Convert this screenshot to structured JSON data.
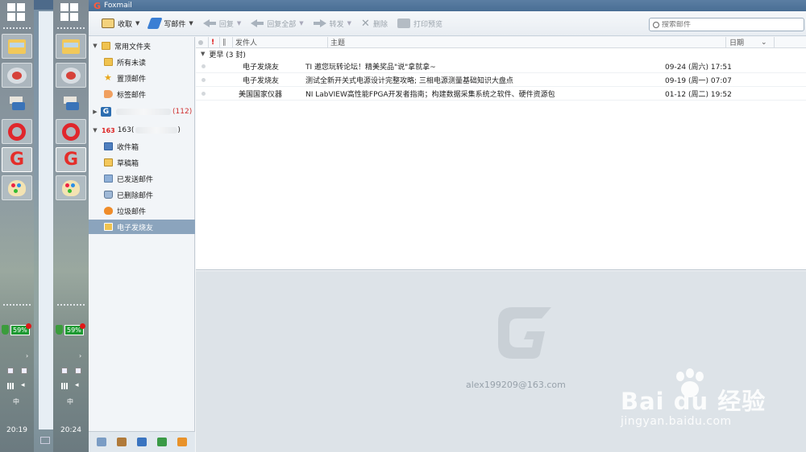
{
  "window": {
    "title": "Foxmail"
  },
  "toolbar": {
    "receive": "收取",
    "compose": "写邮件",
    "reply": "回复",
    "reply_all": "回复全部",
    "forward": "转发",
    "delete": "删除",
    "print_preview": "打印预览"
  },
  "search": {
    "placeholder": "搜索邮件"
  },
  "tree": {
    "common_folder": "常用文件夹",
    "common_items": [
      "所有未读",
      "置顶邮件",
      "标签邮件"
    ],
    "account2_count": "(112)",
    "account163_prefix": "163",
    "account163_label": "163(",
    "account163_suffix": ")",
    "account163_items": [
      "收件箱",
      "草稿箱",
      "已发送邮件",
      "已删除邮件",
      "垃圾邮件",
      "电子发烧友"
    ]
  },
  "list": {
    "col_sender": "发件人",
    "col_subject": "主题",
    "col_date": "日期",
    "group_label": "更早 (3 封)",
    "rows": [
      {
        "sender": "电子发烧友",
        "subject": "TI 邀您玩转论坛！精美奖品\"说\"拿就拿~",
        "date": "09-24 (周六) 17:51"
      },
      {
        "sender": "电子发烧友",
        "subject": "测试全新开关式电源设计完整攻略; 三相电源测量基础知识大盘点",
        "date": "09-19 (周一) 07:07"
      },
      {
        "sender": "美国国家仪器",
        "subject": "NI LabVIEW高性能FPGA开发者指南；构建数据采集系统之软件、硬件资源包",
        "date": "01-12 (周二) 19:52"
      }
    ]
  },
  "preview": {
    "email": "alex199209@163.com"
  },
  "taskbar": {
    "battery1": "59%",
    "battery2": "59%",
    "ime1": "中",
    "ime2": "中",
    "clock1": "20:19",
    "clock2": "20:24"
  },
  "watermark": {
    "brand": "Bai  du 经验",
    "url": "jingyan.baidu.com"
  },
  "colors": {
    "title_bar": "#496e94",
    "selected_folder": "#8ba4bd",
    "unread_count": "#d03030",
    "preview_bg": "#dde3e8"
  },
  "icons": [
    "windows-start-icon",
    "explorer-icon",
    "snip-icon",
    "python-icon",
    "opera-icon",
    "foxmail-icon",
    "paint-icon"
  ]
}
